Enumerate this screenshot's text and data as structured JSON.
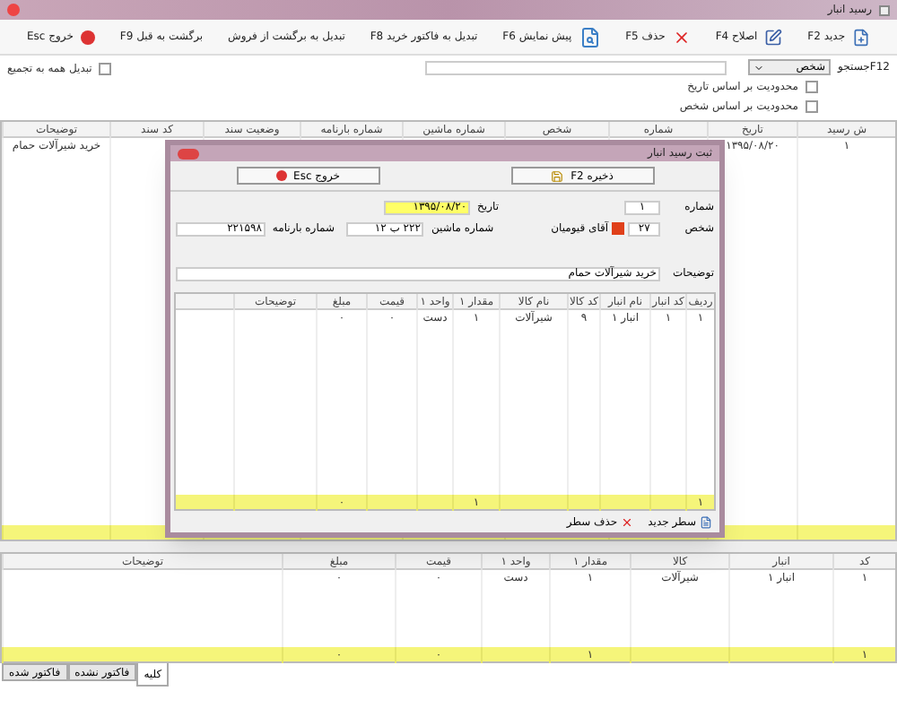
{
  "window": {
    "title": "رسید انبار"
  },
  "toolbar": [
    {
      "label": "جدید F2",
      "kind": "new"
    },
    {
      "label": "اصلاح F4",
      "kind": "edit"
    },
    {
      "label": "حذف F5",
      "kind": "delete"
    },
    {
      "label": "پیش نمایش F6",
      "kind": "preview"
    },
    {
      "label": "تبدیل به فاکتور خرید F8",
      "kind": "text"
    },
    {
      "label": "تبدیل به برگشت از فروش",
      "kind": "text"
    },
    {
      "label": "برگشت به قبل F9",
      "kind": "text"
    },
    {
      "label": "خروج Esc",
      "kind": "exit"
    }
  ],
  "filter": {
    "search_label": "F12جستجو",
    "search_by": "شخص",
    "merge_all": {
      "label": "تبدیل همه به تجمیع",
      "checked": false
    },
    "limits": [
      {
        "label": "محدودیت بر اساس تاریخ",
        "checked": false
      },
      {
        "label": "محدودیت بر اساس شخص",
        "checked": false
      }
    ]
  },
  "receipts_table": {
    "columns": [
      "ش رسید",
      "تاریخ",
      "شماره",
      "شخص",
      "شماره ماشین",
      "شماره بارنامه",
      "وضعیت سند",
      "کد سند",
      "توضیحات"
    ],
    "rows": [
      {
        "number": "۱",
        "date": "۱۳۹۵/۰۸/۲۰",
        "description": "خرید شیرآلات حمام"
      }
    ]
  },
  "items_table": {
    "columns": [
      "کد",
      "انبار",
      "کالا",
      "مقدار ۱",
      "واحد ۱",
      "قیمت",
      "مبلغ",
      "توضیحات"
    ],
    "rows": [
      [
        "۱",
        "انبار ۱",
        "شیرآلات",
        "۱",
        "دست",
        "۰",
        "۰"
      ]
    ],
    "totals": {
      "code": "۱",
      "quantity": "۱",
      "price": "۰",
      "amount": "۰"
    }
  },
  "tabs": [
    {
      "label": "کلیه",
      "selected": true
    },
    {
      "label": "فاکتور نشده",
      "selected": false
    },
    {
      "label": "فاکتور شده",
      "selected": false
    }
  ],
  "dialog": {
    "title": "ثبت رسید انبار",
    "save": "ذخیره F2",
    "exit": "خروج Esc",
    "number_label": "شماره",
    "number": "۱",
    "date_label": "تاریخ",
    "date": "۱۳۹۵/۰۸/۲۰",
    "person_label": "شخص",
    "person_code": "۲۷",
    "person_name": "آقای قیومیان",
    "plate_label": "شماره ماشین",
    "plate": "۲۲۲ ب ۱۲",
    "waybill_label": "شماره بارنامه",
    "waybill": "۲۲۱۵۹۸",
    "notes_label": "توضیحات",
    "notes": "خرید شیرآلات حمام",
    "columns": [
      "ردیف",
      "کد انبار",
      "نام انبار",
      "کد کالا",
      "نام کالا",
      "مقدار ۱",
      "واحد ۱",
      "قیمت",
      "مبلغ",
      "توضیحات"
    ],
    "rows": [
      [
        "۱",
        "۱",
        "انبار ۱",
        "۹",
        "شیرآلات",
        "۱",
        "دست",
        "۰",
        "۰"
      ]
    ],
    "totals": {
      "row": "۱",
      "quantity": "۱",
      "amount": "۰"
    },
    "new_row": "سطر جدید",
    "delete_row": "حذف سطر"
  }
}
